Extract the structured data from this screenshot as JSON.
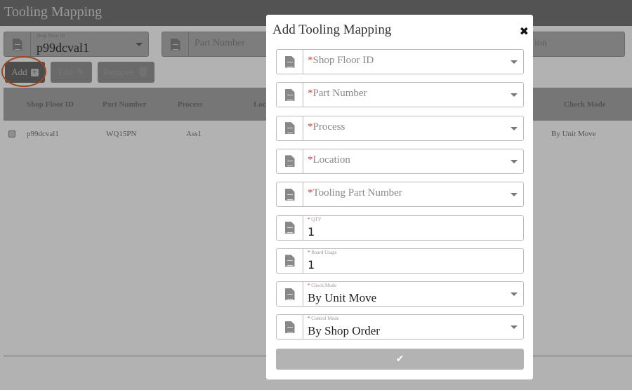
{
  "page": {
    "title": "Tooling Mapping",
    "filters": {
      "shop_floor_label": "Shop Floor ID",
      "shop_floor_value": "p99dcval1",
      "part_number_placeholder": "Part Number",
      "location_placeholder_partial": "ion"
    },
    "buttons": {
      "add": "Add",
      "edit": "Edit",
      "remove": "Remove"
    },
    "table": {
      "headers": [
        "Shop Floor ID",
        "Part Number",
        "Process",
        "Loc",
        "Check Mode"
      ],
      "rows": [
        {
          "shop_floor_id": "p99dcval1",
          "part_number": "WQ15PN",
          "process": "Ass1",
          "check_mode": "By Unit Move"
        }
      ]
    }
  },
  "modal": {
    "title": "Add Tooling Mapping",
    "close_icon": "close-icon",
    "required_mark": "*",
    "fields": [
      {
        "label": "Shop Floor ID",
        "type": "select",
        "value": ""
      },
      {
        "label": "Part Number",
        "type": "select",
        "value": ""
      },
      {
        "label": "Process",
        "type": "select",
        "value": ""
      },
      {
        "label": "Location",
        "type": "select",
        "value": ""
      },
      {
        "label": "Tooling Part Number",
        "type": "select",
        "value": ""
      },
      {
        "label": "QTY",
        "type": "input",
        "value": "1"
      },
      {
        "label": "Board Usage",
        "type": "input",
        "value": "1"
      },
      {
        "label": "Check Mode",
        "type": "select",
        "value": "By Unit Move"
      },
      {
        "label": "Control Mode",
        "type": "select",
        "value": "By Shop Order"
      }
    ],
    "submit_icon": "check-icon"
  },
  "colors": {
    "highlight_ring": "#e8622a",
    "required": "#e33333"
  }
}
